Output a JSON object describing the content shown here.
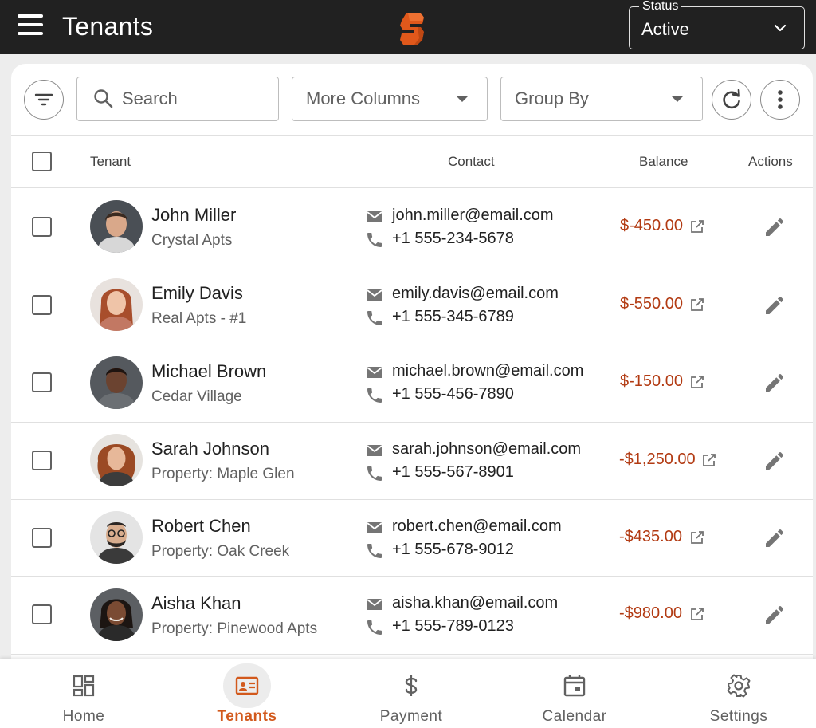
{
  "app": {
    "title": "Tenants"
  },
  "status": {
    "label": "Status",
    "value": "Active"
  },
  "toolbar": {
    "search_placeholder": "Search",
    "more_columns": "More Columns",
    "group_by": "Group By"
  },
  "table": {
    "headers": {
      "tenant": "Tenant",
      "contact": "Contact",
      "balance": "Balance",
      "actions": "Actions"
    },
    "rows": [
      {
        "name": "John Miller",
        "property": "Crystal Apts",
        "email": "john.miller@email.com",
        "phone": "+1 555-234-5678",
        "balance": "$-450.00"
      },
      {
        "name": "Emily Davis",
        "property": "Real Apts - #1",
        "email": "emily.davis@email.com",
        "phone": "+1 555-345-6789",
        "balance": "$-550.00"
      },
      {
        "name": "Michael Brown",
        "property": "Cedar Village",
        "email": "michael.brown@email.com",
        "phone": "+1 555-456-7890",
        "balance": "$-150.00"
      },
      {
        "name": "Sarah Johnson",
        "property": "Property: Maple Glen",
        "email": "sarah.johnson@email.com",
        "phone": "+1 555-567-8901",
        "balance": "-$1,250.00"
      },
      {
        "name": "Robert Chen",
        "property": "Property: Oak Creek",
        "email": "robert.chen@email.com",
        "phone": "+1 555-678-9012",
        "balance": "-$435.00"
      },
      {
        "name": "Aisha Khan",
        "property": "Property: Pinewood Apts",
        "email": "aisha.khan@email.com",
        "phone": "+1 555-789-0123",
        "balance": "-$980.00"
      }
    ]
  },
  "nav": {
    "items": [
      {
        "label": "Home",
        "icon": "dashboard-icon"
      },
      {
        "label": "Tenants",
        "icon": "id-card-icon",
        "active": true
      },
      {
        "label": "Payment",
        "icon": "dollar-icon"
      },
      {
        "label": "Calendar",
        "icon": "calendar-icon"
      },
      {
        "label": "Settings",
        "icon": "gear-icon"
      }
    ]
  },
  "colors": {
    "appbar": "#212121",
    "accent": "#e0581b",
    "balance_negative": "#b23a12",
    "active_nav": "#d2591c"
  }
}
